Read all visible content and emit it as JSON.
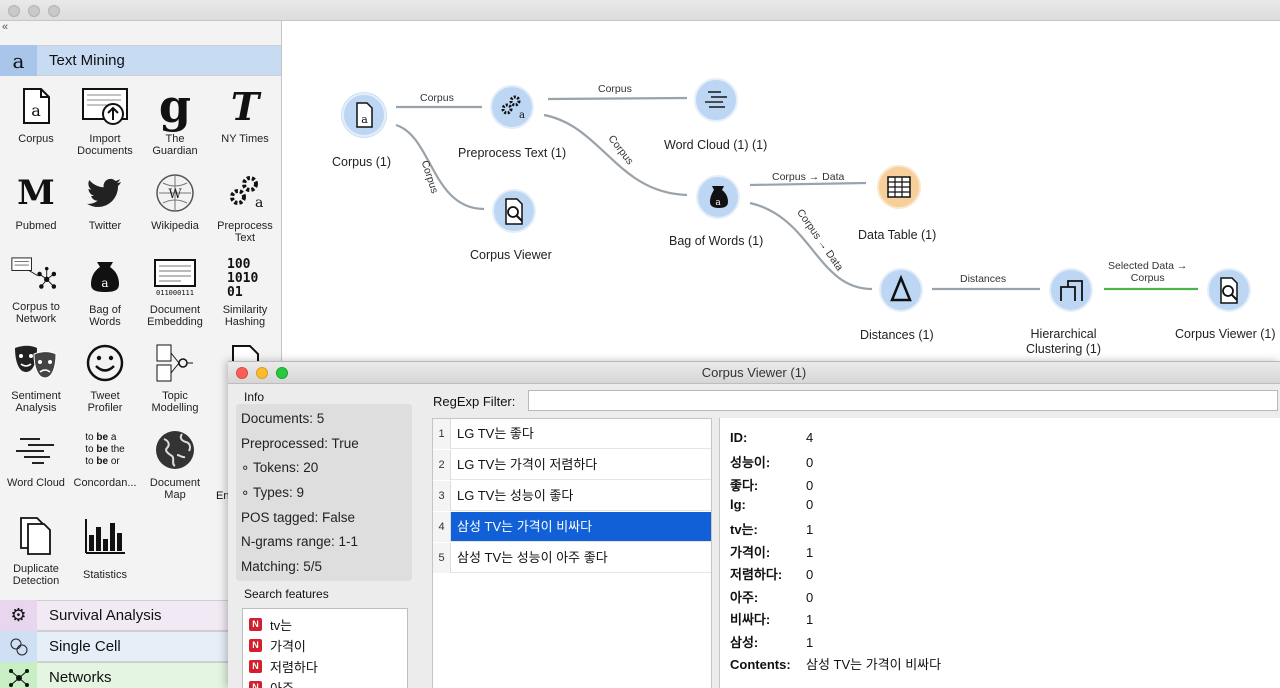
{
  "app": {
    "toolbox": {
      "active_category": "Text Mining",
      "widgets": [
        {
          "label": "Corpus",
          "icon": "corpus-icon"
        },
        {
          "label": "Import\nDocuments",
          "icon": "import-documents-icon"
        },
        {
          "label": "The\nGuardian",
          "icon": "guardian-icon"
        },
        {
          "label": "NY Times",
          "icon": "nytimes-icon"
        },
        {
          "label": "Pubmed",
          "icon": "pubmed-icon"
        },
        {
          "label": "Twitter",
          "icon": "twitter-icon"
        },
        {
          "label": "Wikipedia",
          "icon": "wikipedia-icon"
        },
        {
          "label": "Preprocess\nText",
          "icon": "preprocess-icon"
        },
        {
          "label": "Corpus to\nNetwork",
          "icon": "network-icon"
        },
        {
          "label": "Bag of\nWords",
          "icon": "bag-icon"
        },
        {
          "label": "Document\nEmbedding",
          "icon": "embedding-icon"
        },
        {
          "label": "Similarity\nHashing",
          "icon": "hashing-icon"
        },
        {
          "label": "Sentiment\nAnalysis",
          "icon": "masks-icon"
        },
        {
          "label": "Tweet\nProfiler",
          "icon": "smiley-icon"
        },
        {
          "label": "Topic\nModelling",
          "icon": "topic-icon"
        },
        {
          "label": "Word Cloud",
          "icon": "wordcloud-icon"
        },
        {
          "label": "Concordan...",
          "icon": "concordance-icon"
        },
        {
          "label": "Document\nMap",
          "icon": "globe-icon"
        },
        {
          "label": "Duplicate\nDetection",
          "icon": "duplicate-icon"
        },
        {
          "label": "Statistics",
          "icon": "statistics-icon"
        }
      ],
      "partial_label": "En",
      "categories": [
        {
          "label": "Survival Analysis",
          "color": "#e8d6ee"
        },
        {
          "label": "Single Cell",
          "color": "#cfe0f5"
        },
        {
          "label": "Networks",
          "color": "#c8eec3"
        }
      ]
    },
    "canvas": {
      "nodes": [
        {
          "id": "corpus",
          "label": "Corpus (1)"
        },
        {
          "id": "preprocess",
          "label": "Preprocess Text (1)"
        },
        {
          "id": "wordcloud",
          "label": "Word Cloud (1) (1)"
        },
        {
          "id": "corpusviewer",
          "label": "Corpus Viewer"
        },
        {
          "id": "bow",
          "label": "Bag of Words (1)"
        },
        {
          "id": "datatable",
          "label": "Data Table (1)"
        },
        {
          "id": "distances",
          "label": "Distances (1)"
        },
        {
          "id": "hclust",
          "label": "Hierarchical\nClustering (1)"
        },
        {
          "id": "corpusviewer1",
          "label": "Corpus Viewer (1)"
        }
      ],
      "links": [
        {
          "label": "Corpus"
        },
        {
          "label": "Corpus"
        },
        {
          "label": "Corpus"
        },
        {
          "label": "Corpus"
        },
        {
          "label": "Corpus → Data"
        },
        {
          "label": "Corpus → Data"
        },
        {
          "label": "Distances"
        },
        {
          "label": "Selected Data →\nCorpus"
        }
      ]
    }
  },
  "viewer": {
    "title": "Corpus Viewer (1)",
    "info_title": "Info",
    "info": [
      "Documents: 5",
      "Preprocessed: True",
      "∘ Tokens: 20",
      "∘ Types: 9",
      "POS tagged: False",
      "N-grams range: 1-1",
      "Matching: 5/5"
    ],
    "search_title": "Search features",
    "features": [
      "tv는",
      "가격이",
      "저렴하다",
      "아주"
    ],
    "feature_badge": "N",
    "filter_label": "RegExp Filter:",
    "filter_value": "",
    "documents": [
      {
        "num": "1",
        "text": "LG TV는 좋다"
      },
      {
        "num": "2",
        "text": "LG TV는 가격이 저렴하다"
      },
      {
        "num": "3",
        "text": "LG TV는 성능이 좋다"
      },
      {
        "num": "4",
        "text": "삼성 TV는 가격이 비싸다"
      },
      {
        "num": "5",
        "text": "삼성 TV는 성능이 아주 좋다"
      }
    ],
    "selected_index": 3,
    "details": [
      {
        "key": "ID:",
        "value": "4"
      },
      {
        "key": "성능이:",
        "value": "0"
      },
      {
        "key": "좋다:",
        "value": "0"
      },
      {
        "key": "lg:",
        "value": "0"
      },
      {
        "key": "tv는:",
        "value": "1"
      },
      {
        "key": "가격이:",
        "value": "1"
      },
      {
        "key": "저렴하다:",
        "value": "0"
      },
      {
        "key": "아주:",
        "value": "0"
      },
      {
        "key": "비싸다:",
        "value": "1"
      },
      {
        "key": "삼성:",
        "value": "1"
      },
      {
        "key": "Contents:",
        "value": "삼성 TV는 가격이 비싸다"
      }
    ]
  }
}
